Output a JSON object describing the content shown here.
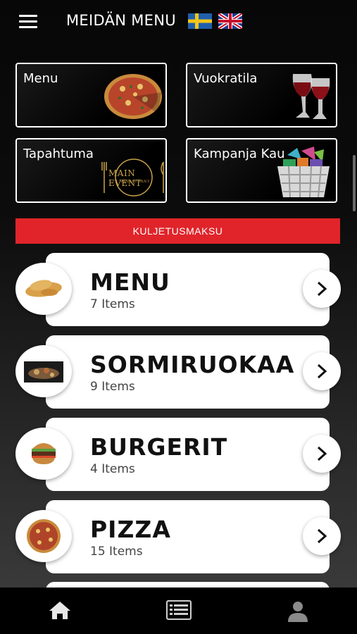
{
  "header": {
    "title": "MEIDÄN MENU",
    "languages": [
      "sv-flag-icon",
      "uk-flag-icon"
    ]
  },
  "tiles": [
    {
      "label": "Menu",
      "image": "pizza-image"
    },
    {
      "label": "Vuokratila",
      "image": "wine-glasses-image"
    },
    {
      "label": "Tapahtuma",
      "image": "main-event-logo",
      "logo_text": "MAIN EVENT",
      "logo_subtext": "RESTAURANT"
    },
    {
      "label": "Kampanja Kau",
      "image": "shopping-basket-image"
    }
  ],
  "delivery_fee": {
    "label": "KULJETUSMAKSU",
    "color": "#e0242a"
  },
  "categories": [
    {
      "name": "MENU",
      "count": "7 Items"
    },
    {
      "name": "SORMIRUOKAA",
      "count": "9 Items"
    },
    {
      "name": "BURGERIT",
      "count": "4 Items"
    },
    {
      "name": "PIZZA",
      "count": "15 Items"
    }
  ],
  "bottom_nav": [
    "home-icon",
    "menu-list-icon",
    "profile-icon"
  ]
}
